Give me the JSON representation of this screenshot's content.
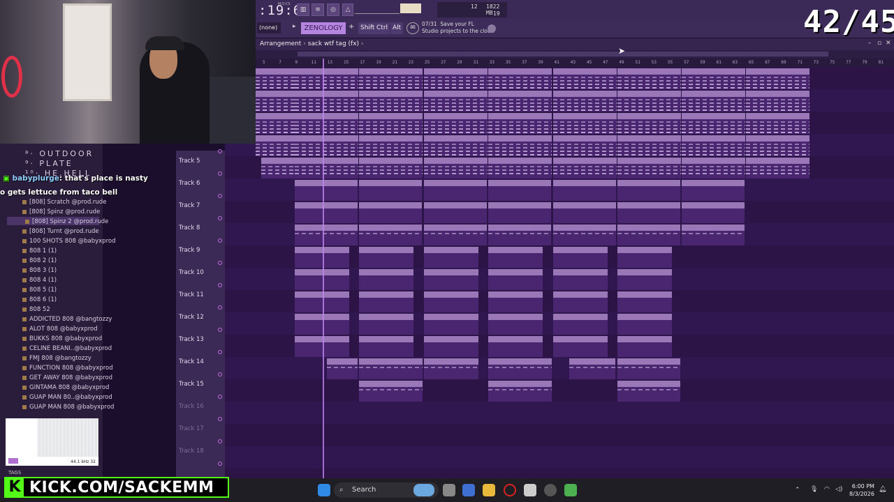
{
  "overlay": {
    "score": "42/45",
    "kick": "KICK.COM/SACKEMM"
  },
  "transport": {
    "time": ":19:69",
    "time_label": "M:S:CS",
    "cpu_top": "12",
    "mem": "1822 MB",
    "poly": "19"
  },
  "toolbar2": {
    "pattern_select": "(none)",
    "pattern_name": "ZENOLOGY",
    "keys": [
      "Shift",
      "Ctrl",
      "Alt"
    ],
    "news_date": "07/31",
    "news_line1": "Save your FL",
    "news_line2": "Studio projects to the cloud"
  },
  "arrangement": {
    "label": "Arrangement",
    "breadcrumb": "sack wtf tag (fx)"
  },
  "ruler": [
    "5",
    "7",
    "9",
    "11",
    "13",
    "15",
    "17",
    "19",
    "21",
    "23",
    "25",
    "27",
    "29",
    "31",
    "33",
    "35",
    "37",
    "39",
    "41",
    "43",
    "45",
    "47",
    "49",
    "51",
    "53",
    "55",
    "57",
    "59",
    "61",
    "63",
    "65",
    "67",
    "69",
    "71",
    "73",
    "75",
    "77",
    "79",
    "81"
  ],
  "chat": [
    {
      "user": "babyplurge",
      "text": ": that's place is nasty"
    },
    {
      "user": "",
      "text": "o gets lettuce from taco bell"
    }
  ],
  "browser": {
    "headers": [
      "⁸· OUTDOOR",
      "⁹· PLATE",
      "¹⁰· HE.HELL"
    ],
    "items": [
      "[808] Scratch @prod.rude",
      "[808] Spinz @prod.rude",
      "[808] Spinz 2 @prod.rude",
      "[808] Turnt @prod.rude",
      "100 SHOTS 808 @babyxprod",
      "808 1 (1)",
      "808 2 (1)",
      "808 3 (1)",
      "808 4 (1)",
      "808 5 (1)",
      "808 6 (1)",
      "808 52",
      "ADDICTED 808 @bangtozzy",
      "ALOT 808 @babyxprod",
      "BUKKS 808 @babyxprod",
      "CELINE BEANI..@babyxprod",
      "FMJ 808 @bangtozzy",
      "FUNCTION 808 @babyxprod",
      "GET AWAY 808 @babyxprod",
      "GINTAMA 808 @babyxprod",
      "GUAP MAN 80..@babyxprod",
      "GUAP MAN 808 @babyxprod"
    ],
    "preview_freq": "44.1 kHz 32",
    "tags_label": "TAGS"
  },
  "tracks": [
    {
      "name": "Track 5"
    },
    {
      "name": "Track 6"
    },
    {
      "name": "Track 7"
    },
    {
      "name": "Track 8"
    },
    {
      "name": "Track 9"
    },
    {
      "name": "Track 10"
    },
    {
      "name": "Track 11"
    },
    {
      "name": "Track 12"
    },
    {
      "name": "Track 13"
    },
    {
      "name": "Track 14"
    },
    {
      "name": "Track 15"
    },
    {
      "name": "Track 16"
    },
    {
      "name": "Track 17"
    },
    {
      "name": "Track 18"
    }
  ],
  "clip_labels": {
    "zen1": "ZENOLOGY",
    "zen2": "ZENOLOGY #2",
    "zen3": "ZENOLOGY #3",
    "zen4": "ZENOLOGY #4",
    "zen5": "ZENOLOGY #5",
    "zen5s": "ZENO..GY #5",
    "t6": "[Clap] Squeeze @prod.rude",
    "t6s": "[Clap] Squ..@prod.rude",
    "t7": "[OPEN HAT]..h @prod.rude",
    "t7s": "[OPEN HAT]..@prod.rude",
    "t7b": "ITS A PARTY..l @babyxprod",
    "t8": "GINTAMA Op..@babyxprod",
    "t8s": "GINTAMA O..@babyxprod",
    "t8b": "[808] Spinz 2 @prod.rude",
    "t9": "FMJ Hat @bangtozzy",
    "t10": "perc 2 (1)",
    "t11": "LAZER @prod.rude",
    "t12": "MAAG DUMP C..@bangtozzy",
    "t12s": "MAAG DUMP..bangtozzy",
    "t13": "ITS A PARTY..l @babyxprod",
    "t13s": "ITS A PART..babyxprod",
    "t14a": "[808]...rude",
    "t14b": "IN IT Snare..ll @babyxprod",
    "t14c": "[808] Spinz..prod.rude",
    "t14d": "[808] Spin..rod.rude",
    "t15": "[808] Spinz 2 @prod.rude"
  },
  "taskbar": {
    "search": "Search",
    "time": "6:00 PM",
    "date": "8/3/2026"
  }
}
